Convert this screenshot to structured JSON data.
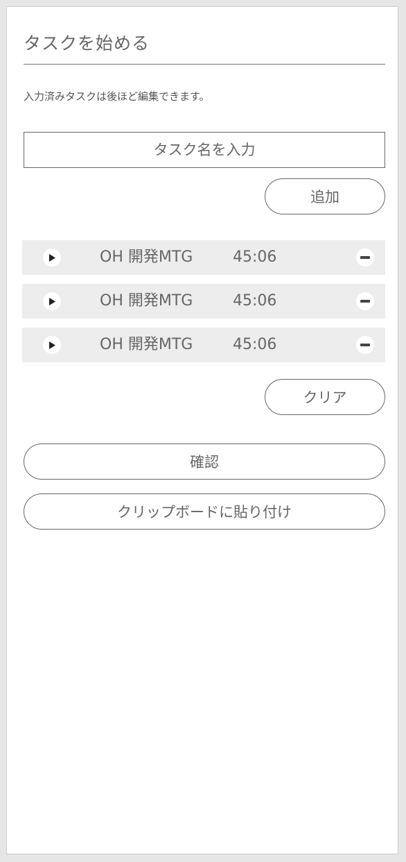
{
  "header": {
    "title": "タスクを始める"
  },
  "hint": "入力済みタスクは後ほど編集できます。",
  "task_input": {
    "placeholder": "タスク名を入力",
    "value": ""
  },
  "buttons": {
    "add": "追加",
    "clear": "クリア",
    "confirm": "確認",
    "paste": "クリップボードに貼り付け"
  },
  "tasks": [
    {
      "name": "OH 開発MTG",
      "time": "45:06"
    },
    {
      "name": "OH 開発MTG",
      "time": "45:06"
    },
    {
      "name": "OH 開発MTG",
      "time": "45:06"
    }
  ],
  "icons": {
    "play": "play-icon",
    "remove": "minus-icon"
  },
  "colors": {
    "background": "#e6e6e6",
    "row_background": "#ededed",
    "text": "#666666",
    "border": "#666666"
  }
}
